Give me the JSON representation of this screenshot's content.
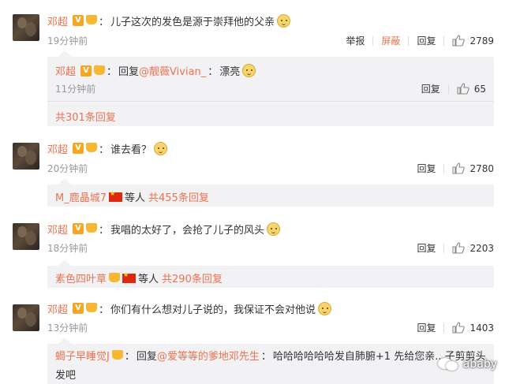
{
  "comments": [
    {
      "user": "邓超",
      "v_badge": "V",
      "text": "儿子这次的发色是源于崇拜他的父亲",
      "time": "19分钟前",
      "report": "举报",
      "block": "屏蔽",
      "reply": "回复",
      "likes": "2789",
      "sub": {
        "user": "邓超",
        "reply_prefix": "回复",
        "reply_to": "@靓薇Vivian_",
        "text": "漂亮",
        "time": "11分钟前",
        "reply": "回复",
        "likes": "65",
        "more": "共301条回复"
      }
    },
    {
      "user": "邓超",
      "v_badge": "V",
      "text": "谁去看？",
      "time": "20分钟前",
      "reply": "回复",
      "likes": "2780",
      "summary": {
        "user": "M_鹿晶城7",
        "others": "等人",
        "more": "共455条回复"
      }
    },
    {
      "user": "邓超",
      "v_badge": "V",
      "text": "我唱的太好了，会抢了儿子的风头",
      "time": "18分钟前",
      "reply": "回复",
      "likes": "2203",
      "summary": {
        "user": "素色四叶草",
        "others": "等人",
        "more": "共290条回复"
      }
    },
    {
      "user": "邓超",
      "v_badge": "V",
      "text": "你们有什么想对儿子说的，我保证不会对他说",
      "time": "13分钟前",
      "reply": "回复",
      "likes": "1403",
      "sub": {
        "user": "蝎子早睡觉J",
        "reply_prefix": "回复",
        "reply_to": "@爱等等的爹地邓先生",
        "text": "哈哈哈哈哈哈发自肺腑+1 先给您亲...子剪剪头",
        "text2": "发吧"
      }
    }
  ],
  "watermark": "ababy",
  "icons": {
    "like": "thumbs-up-icon",
    "emoji": "doge-emoji-icon",
    "flag": "china-flag-icon",
    "vip": "vip-crown-icon"
  },
  "colors": {
    "accent": "#eb7350",
    "muted": "#999999",
    "badge": "#f5a623",
    "sub_bg": "#f2f2f5"
  }
}
